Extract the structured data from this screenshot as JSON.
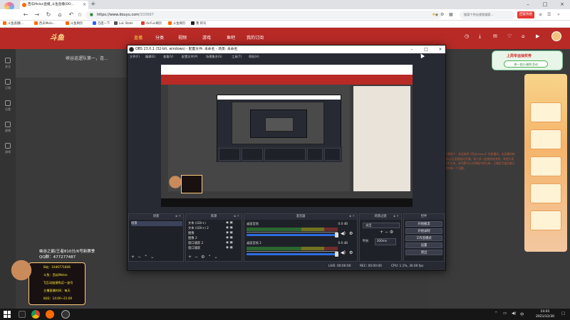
{
  "browser": {
    "profile_tag": "云帆播放",
    "tab_title": "西瓜Melon直播_斗鱼直播(DO...",
    "url_host": "https://www.douyu.com",
    "url_path": "/103687",
    "search_placeholder": "搜索个性化视频搜索...",
    "brand_tag": "回复快搜",
    "bookmarks": [
      "斗鱼直播(...",
      "西瓜Melo...",
      "斗鱼网页",
      "百度一下",
      "LoL Stats",
      "AirFun网页",
      "斗鱼网页",
      "我 的号"
    ]
  },
  "site": {
    "logo": "斗鱼",
    "nav": [
      "直播",
      "分类",
      "视频",
      "游戏",
      "鱼吧",
      "我的订阅"
    ],
    "promo_title": "上周幸运抽奖券",
    "promo_button": "再一组小福利活动",
    "left_rail": [
      "关注",
      "订阅",
      "分类",
      "视频",
      "游戏"
    ],
    "info_title": "峡谷巡逻队第一，连...",
    "right_text": "主播简介：欢迎来到【西瓜Melon】的直播间，本直播间每晚8点至凌晨准时开播，和大家一起愉快地游戏，希望大家多多支持，有问题可以在弹幕中提出来，主播会尽量回复大家的每一个问题。",
    "stream_line1": "峡谷之巅/王者810分/6号新赛季",
    "stream_line2": "QQ群：477277487",
    "card_lines": [
      "B站：1046771606",
      "斗鱼：西瓜Melon",
      "TJ互动链接购买一波号",
      "主播直播时间：每天",
      "时间：14:00~21:00"
    ]
  },
  "obs": {
    "title": "OBS 23.0.1 (32-bit, windows) - 配置文件: 未命名 - 场景: 未命名",
    "menu": [
      "文件(F)",
      "编辑(E)",
      "查看(V)",
      "配置文件(P)",
      "场景集合(S)",
      "工具(T)",
      "帮助(H)"
    ],
    "docks": {
      "scenes": {
        "title": "场景",
        "items": [
          "场景"
        ]
      },
      "sources": {
        "title": "来源",
        "items": [
          "文本 (GDI+)",
          "文本 (GDI+) 2",
          "图像",
          "图像 2",
          "窗口捕获 2",
          "窗口捕获"
        ]
      },
      "mixer": {
        "title": "混音器",
        "channels": [
          {
            "name": "桌面音频",
            "db": "0.0 dB"
          },
          {
            "name": "桌面音频 2",
            "db": "0.0 dB"
          }
        ]
      },
      "transitions": {
        "title": "场景过渡",
        "selected": "淡出",
        "duration_label": "时长",
        "duration": "300ms"
      },
      "controls": {
        "title": "控件",
        "buttons": [
          "开始推流",
          "开始录制",
          "工作室模式",
          "设置",
          "退出"
        ]
      }
    },
    "status": {
      "live": "LIVE: 00:00:00",
      "rec": "REC: 00:00:00",
      "cpu": "CPU: 1.1%, 30.00 fps"
    }
  },
  "taskbar": {
    "time": "14:01",
    "date": "2021/12/30"
  }
}
